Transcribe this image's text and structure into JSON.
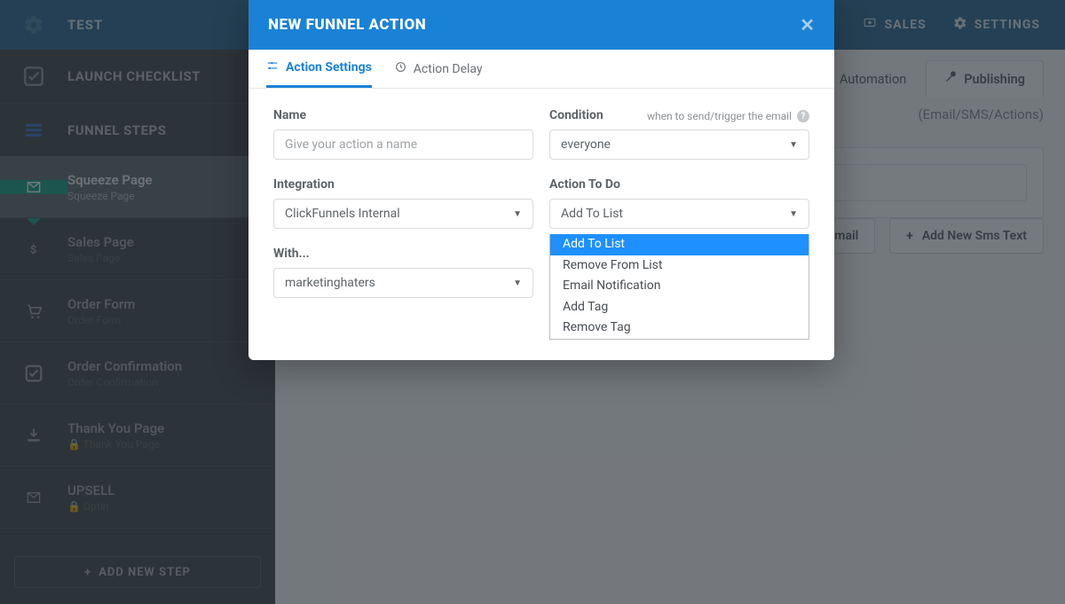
{
  "topbar": {
    "brand": "TEST",
    "links": {
      "sales": "SALES",
      "settings": "SETTINGS"
    }
  },
  "sidebar": {
    "launch_checklist": "LAUNCH CHECKLIST",
    "funnel_steps": "FUNNEL STEPS",
    "steps": [
      {
        "title": "Squeeze Page",
        "sub": "Squeeze Page",
        "icon": "envelope",
        "active": true
      },
      {
        "title": "Sales Page",
        "sub": "Sales Page",
        "icon": "dollar"
      },
      {
        "title": "Order Form",
        "sub": "Order Form",
        "icon": "cart"
      },
      {
        "title": "Order Confirmation",
        "sub": "Order Confirmation",
        "icon": "check-square"
      },
      {
        "title": "Thank You Page",
        "sub": "Thank You Page",
        "icon": "download",
        "prefix": "🔒"
      },
      {
        "title": "UPSELL",
        "sub": "Optin",
        "icon": "envelope",
        "prefix": "🔒"
      }
    ],
    "add_new_step": "ADD NEW STEP"
  },
  "main": {
    "tabs": {
      "automation": "Automation",
      "publishing": "Publishing"
    },
    "subline": "(Email/SMS/Actions)",
    "buttons": {
      "add_email": "Add New Email",
      "add_sms": "Add New Sms Text"
    }
  },
  "modal": {
    "title": "NEW FUNNEL ACTION",
    "tabs": {
      "settings": "Action Settings",
      "delay": "Action Delay"
    },
    "fields": {
      "name_label": "Name",
      "name_placeholder": "Give your action a name",
      "condition_label": "Condition",
      "condition_hint": "when to send/trigger the email",
      "condition_value": "everyone",
      "integration_label": "Integration",
      "integration_value": "ClickFunnels Internal",
      "action_label": "Action To Do",
      "action_value": "Add To List",
      "with_label": "With...",
      "with_value": "marketinghaters"
    },
    "action_options": [
      "Add To List",
      "Remove From List",
      "Email Notification",
      "Add Tag",
      "Remove Tag"
    ]
  }
}
